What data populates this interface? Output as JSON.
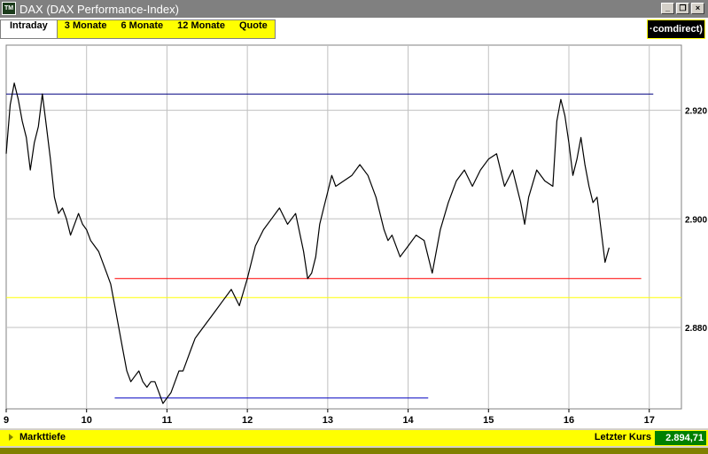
{
  "window": {
    "icon_label": "TM",
    "title": "DAX (DAX Performance-Index)",
    "buttons": {
      "minimize": "_",
      "restore": "❐",
      "close": "×"
    }
  },
  "tabs": [
    {
      "label": "Intraday",
      "active": true
    },
    {
      "label": "3 Monate",
      "active": false
    },
    {
      "label": "6 Monate",
      "active": false
    },
    {
      "label": "12 Monate",
      "active": false
    },
    {
      "label": "Quote",
      "active": false
    }
  ],
  "logo_text": "·comdirect)",
  "status": {
    "left_label": "Markttiefe",
    "right_label": "Letzter Kurs",
    "last_price": "2.894,71"
  },
  "colors": {
    "tab_background": "#ffff00",
    "price_line": "#000000",
    "resistance_line": "#000080",
    "support_line": "#ff0000",
    "low_line": "#0000c0",
    "reference_line": "#ffff00",
    "last_price_bg": "#008000"
  },
  "chart_data": {
    "type": "line",
    "title": "",
    "xlabel": "",
    "ylabel": "",
    "x_ticks": [
      9,
      10,
      11,
      12,
      13,
      14,
      15,
      16,
      17
    ],
    "y_ticks": [
      2880,
      2900,
      2920
    ],
    "y_tick_labels": [
      "2.880",
      "2.900",
      "2.920"
    ],
    "xlim": [
      9,
      17.4
    ],
    "ylim": [
      2865,
      2932
    ],
    "grid": true,
    "series": [
      {
        "color": "#000000",
        "x": [
          9.0,
          9.05,
          9.1,
          9.15,
          9.2,
          9.25,
          9.3,
          9.35,
          9.4,
          9.45,
          9.5,
          9.55,
          9.6,
          9.65,
          9.7,
          9.75,
          9.8,
          9.85,
          9.9,
          9.95,
          10.0,
          10.05,
          10.1,
          10.15,
          10.2,
          10.25,
          10.3,
          10.35,
          10.4,
          10.45,
          10.5,
          10.55,
          10.6,
          10.65,
          10.7,
          10.75,
          10.8,
          10.85,
          10.9,
          10.95,
          11.0,
          11.05,
          11.1,
          11.15,
          11.2,
          11.25,
          11.3,
          11.35,
          11.4,
          11.5,
          11.6,
          11.7,
          11.8,
          11.9,
          12.0,
          12.1,
          12.2,
          12.3,
          12.4,
          12.5,
          12.6,
          12.7,
          12.75,
          12.8,
          12.85,
          12.9,
          12.95,
          13.0,
          13.05,
          13.1,
          13.2,
          13.3,
          13.4,
          13.5,
          13.6,
          13.7,
          13.75,
          13.8,
          13.9,
          14.0,
          14.1,
          14.2,
          14.3,
          14.4,
          14.5,
          14.6,
          14.7,
          14.8,
          14.9,
          15.0,
          15.1,
          15.2,
          15.3,
          15.4,
          15.45,
          15.5,
          15.6,
          15.7,
          15.8,
          15.85,
          15.9,
          15.95,
          16.0,
          16.05,
          16.1,
          16.15,
          16.2,
          16.25,
          16.3,
          16.35,
          16.4,
          16.45,
          16.5
        ],
        "y": [
          2912,
          2921,
          2925,
          2922,
          2918,
          2915,
          2909,
          2914,
          2917,
          2923,
          2917,
          2911,
          2904,
          2901,
          2902,
          2900,
          2897,
          2899,
          2901,
          2899,
          2898,
          2896,
          2895,
          2894,
          2892,
          2890,
          2888,
          2884,
          2880,
          2876,
          2872,
          2870,
          2871,
          2872,
          2870,
          2869,
          2870,
          2870,
          2868,
          2866,
          2867,
          2868,
          2870,
          2872,
          2872,
          2874,
          2876,
          2878,
          2879,
          2881,
          2883,
          2885,
          2887,
          2884,
          2889,
          2895,
          2898,
          2900,
          2902,
          2899,
          2901,
          2894,
          2889,
          2890,
          2893,
          2899,
          2902,
          2905,
          2908,
          2906,
          2907,
          2908,
          2910,
          2908,
          2904,
          2898,
          2896,
          2897,
          2893,
          2895,
          2897,
          2896,
          2890,
          2898,
          2903,
          2907,
          2909,
          2906,
          2909,
          2911,
          2912,
          2906,
          2909,
          2903,
          2899,
          2904,
          2909,
          2907,
          2906,
          2918,
          2922,
          2919,
          2914,
          2908,
          2911,
          2915,
          2910,
          2906,
          2903,
          2904,
          2898,
          2892,
          2894.7
        ]
      }
    ],
    "horizontal_lines": [
      {
        "name": "resistance",
        "y": 2923,
        "x_start": 9.0,
        "x_end": 17.05,
        "color": "#000080"
      },
      {
        "name": "support",
        "y": 2889,
        "x_start": 10.35,
        "x_end": 16.9,
        "color": "#ff0000"
      },
      {
        "name": "low",
        "y": 2867,
        "x_start": 10.35,
        "x_end": 14.25,
        "color": "#0000c0"
      },
      {
        "name": "reference",
        "y": 2885.5,
        "x_start": 9.0,
        "x_end": 17.4,
        "color": "#ffff00"
      }
    ]
  }
}
